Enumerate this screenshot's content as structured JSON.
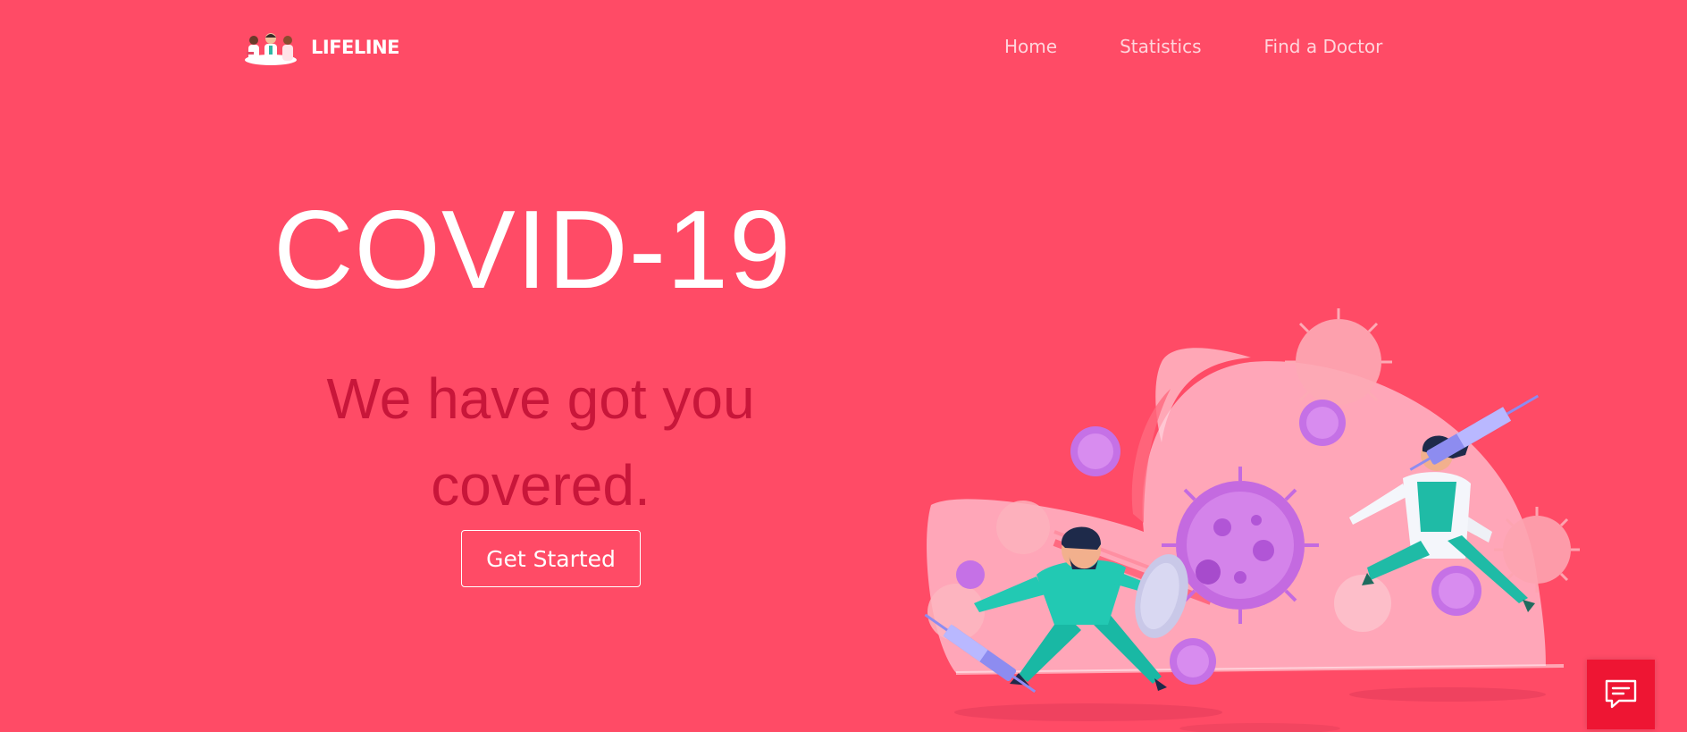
{
  "brand": {
    "name": "LIFELINE",
    "logo_icon": "doctors-group-logo"
  },
  "nav": {
    "items": [
      {
        "label": "Home"
      },
      {
        "label": "Statistics"
      },
      {
        "label": "Find a Doctor"
      }
    ]
  },
  "hero": {
    "title": "COVID-19",
    "subtitle": "We have got you covered.",
    "cta_label": "Get Started",
    "illustration_icon": "doctors-fighting-virus-illustration"
  },
  "chat": {
    "icon": "chat-message-icon"
  },
  "colors": {
    "background": "#ff4b66",
    "subtitle": "#c8163a",
    "chat_button": "#ee1533",
    "white": "#ffffff"
  }
}
